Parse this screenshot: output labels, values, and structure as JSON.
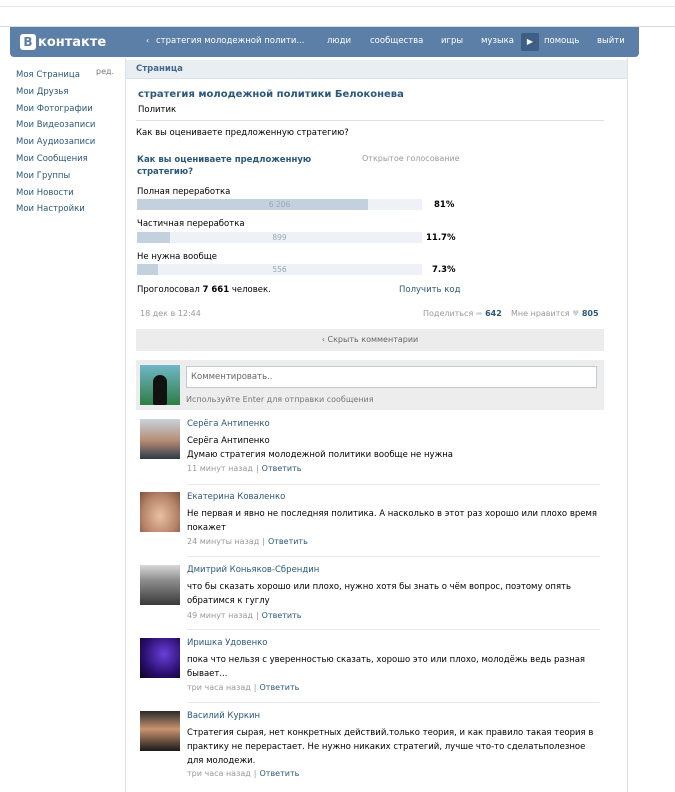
{
  "header": {
    "logo": "контакте",
    "logo_letter": "В",
    "back_glyph": "‹",
    "title": "стратегия молодежной полити...",
    "nav": [
      "люди",
      "сообщества",
      "игры",
      "музыка",
      "помощь",
      "выйти"
    ],
    "play_glyph": "▶"
  },
  "sidebar": {
    "edit": "ред.",
    "items": [
      "Моя Страница",
      "Мои Друзья",
      "Мои Фотографии",
      "Мои Видеозаписи",
      "Мои Аудиозаписи",
      "Мои Сообщения",
      "Мои Группы",
      "Мои Новости",
      "Мои Настройки"
    ]
  },
  "page": {
    "section_title": "Страница",
    "name": "стратегия молодежной политики Белоконева",
    "subtitle": "Политик",
    "question": "Как вы оцениваете предложенную стратегию?"
  },
  "poll": {
    "title_line1": "Как вы оцениваете предложенную",
    "title_line2": "стратегию?",
    "type": "Открытое голосование",
    "options": [
      {
        "label": "Полная переработка",
        "count": "6 206",
        "percent": "81%",
        "fraction": 0.81
      },
      {
        "label": "Частичная переработка",
        "count": "899",
        "percent": "11.7%",
        "fraction": 0.117
      },
      {
        "label": "Не нужна вообще",
        "count": "556",
        "percent": "7.3%",
        "fraction": 0.073
      }
    ],
    "voted_prefix": "Проголосовал",
    "voted_count": "7 661",
    "voted_suffix": "человек.",
    "get_code": "Получить код",
    "date": "18 дек в 12:44",
    "share_label": "Поделиться",
    "share_count": "642",
    "like_label": "Мне нравится",
    "like_count": "805"
  },
  "comments_ui": {
    "hide": "‹ Скрыть комментарии",
    "placeholder": "Комментировать..",
    "hint": "Используйте Enter для отправки сообщения",
    "reply": "Ответить",
    "sep": "|"
  },
  "comments": [
    {
      "name": "Серёга Антипенко",
      "text": "Серёга Антипенко\nДумаю стратегия молодежной политики вообще не нужна",
      "time": "11 минут назад"
    },
    {
      "name": "Екатерина Коваленко",
      "text": "Не первая и явно не последняя политика. А насколько в этот раз хорошо или плохо время покажет",
      "time": "24 минуты назад"
    },
    {
      "name": "Дмитрий Коньяков-Сбрендин",
      "text": "что бы сказать хорошо или плохо, нужно хотя бы знать о чём вопрос, поэтому опять обратимся к гуглу",
      "time": "49 минут назад"
    },
    {
      "name": "Иришка Удовенко",
      "text": "пока что нельзя с уверенностью сказать, хорошо это или плохо, молодёжь ведь разная бывает...",
      "time": "три часа назад"
    },
    {
      "name": "Василий Куркин",
      "text": "Стратегия сырая, нет конкретных действий.только теория, и как правило такая теория в практику не перерастает. Не нужно никаких стратегий, лучше что-то сделатьполезное для молодежи.",
      "time": "три часа назад"
    }
  ]
}
